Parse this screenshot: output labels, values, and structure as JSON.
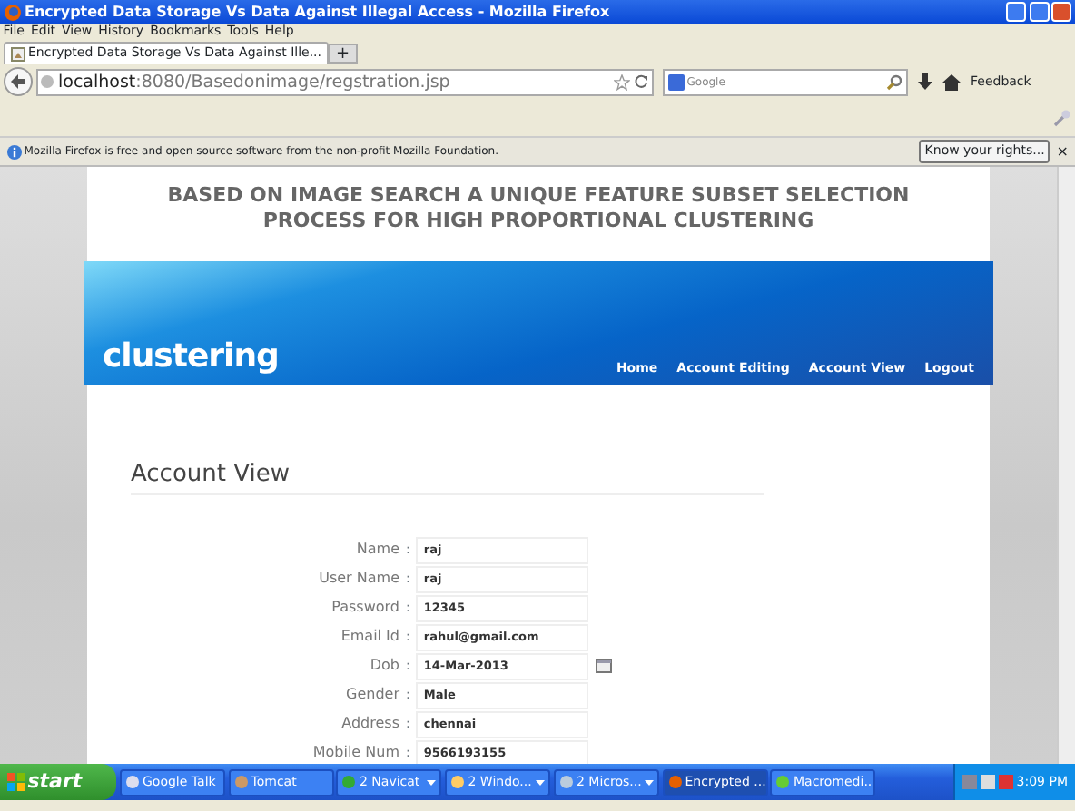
{
  "window": {
    "title": "Encrypted Data Storage Vs Data Against Illegal Access - Mozilla Firefox"
  },
  "menu": [
    "File",
    "Edit",
    "View",
    "History",
    "Bookmarks",
    "Tools",
    "Help"
  ],
  "tabs": [
    {
      "label": "Encrypted Data Storage Vs Data Against Ille...",
      "selected": true
    }
  ],
  "new_tab": "+",
  "address": {
    "host": "localhost",
    "path": ":8080/Basedonimage/regstration.jsp"
  },
  "search": {
    "placeholder": "Google"
  },
  "feedback": "Feedback",
  "notification": {
    "text": "Mozilla Firefox is free and open source software from the non-profit Mozilla Foundation.",
    "button": "Know your rights...",
    "close": "×"
  },
  "page": {
    "heading": "BASED ON IMAGE SEARCH A UNIQUE FEATURE SUBSET SELECTION PROCESS FOR HIGH PROPORTIONAL CLUSTERING",
    "logo": "clustering",
    "nav": [
      "Home",
      "Account Editing",
      "Account View",
      "Logout"
    ],
    "section_title": "Account View",
    "fields": [
      {
        "label": "Name",
        "separator": ":",
        "value": "raj",
        "kind": "text"
      },
      {
        "label": "User Name",
        "separator": ":",
        "value": "raj",
        "kind": "text"
      },
      {
        "label": "Password",
        "separator": ":",
        "value": "12345",
        "kind": "text"
      },
      {
        "label": "Email Id",
        "separator": ":",
        "value": "rahul@gmail.com",
        "kind": "text"
      },
      {
        "label": "Dob",
        "separator": ":",
        "value": "14-Mar-2013",
        "kind": "date"
      },
      {
        "label": "Gender",
        "separator": ":",
        "value": "Male",
        "kind": "text"
      },
      {
        "label": "Address",
        "separator": ":",
        "value": "chennai",
        "kind": "text"
      },
      {
        "label": "Mobile Num",
        "separator": ":",
        "value": "9566193155",
        "kind": "text"
      }
    ]
  },
  "taskbar": {
    "start": "start",
    "items": [
      {
        "label": "Google Talk",
        "menu": false,
        "selected": false
      },
      {
        "label": "Tomcat",
        "menu": false,
        "selected": false
      },
      {
        "label": "2 Navicat",
        "menu": true,
        "selected": false
      },
      {
        "label": "2 Windo...",
        "menu": true,
        "selected": false
      },
      {
        "label": "2 Micros...",
        "menu": true,
        "selected": false
      },
      {
        "label": "Encrypted ...",
        "menu": false,
        "selected": true
      },
      {
        "label": "Macromedi...",
        "menu": false,
        "selected": false
      }
    ],
    "clock": "3:09 PM"
  }
}
